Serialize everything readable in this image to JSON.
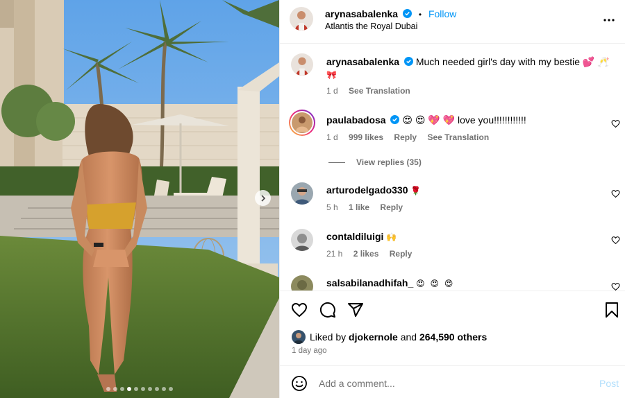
{
  "post": {
    "author": "arynasabalenka",
    "follow_label": "Follow",
    "separator": "•",
    "location": "Atlantis the Royal Dubai",
    "caption_line1": "Much needed girl's day with my bestie 💕 🥂",
    "caption_line2": "🎀",
    "caption_time": "1 d",
    "see_translation": "See Translation",
    "carousel": {
      "slide_count": 10,
      "active_index": 3
    }
  },
  "comments": [
    {
      "user": "paulabadosa",
      "verified": true,
      "text": "😍 😍 💖 💖 love you!!!!!!!!!!!!",
      "time": "1 d",
      "likes": "999 likes",
      "reply": "Reply",
      "translate": "See Translation",
      "replies": "View replies (35)"
    },
    {
      "user": "arturodelgado330",
      "verified": false,
      "text": "🌹",
      "time": "5 h",
      "likes": "1 like",
      "reply": "Reply"
    },
    {
      "user": "contaldiluigi",
      "verified": false,
      "text": "🙌",
      "time": "21 h",
      "likes": "2 likes",
      "reply": "Reply"
    },
    {
      "user": "salsabilanadhifah_",
      "verified": false,
      "text": "😍 😍 😍"
    }
  ],
  "likes": {
    "prefix": "Liked by",
    "user": "djokernole",
    "middle": "and",
    "count": "264,590 others"
  },
  "timestamp": "1 day ago",
  "composer": {
    "placeholder": "Add a comment...",
    "post_label": "Post"
  },
  "icons": [
    "heart-icon",
    "comment-icon",
    "share-icon",
    "bookmark-icon",
    "more-icon",
    "emoji-icon",
    "verified-icon",
    "chevron-right-icon"
  ],
  "colors": {
    "link": "#0095f6",
    "muted": "#737373",
    "post_disabled": "#b2dffc",
    "verified": "#0095f6"
  }
}
